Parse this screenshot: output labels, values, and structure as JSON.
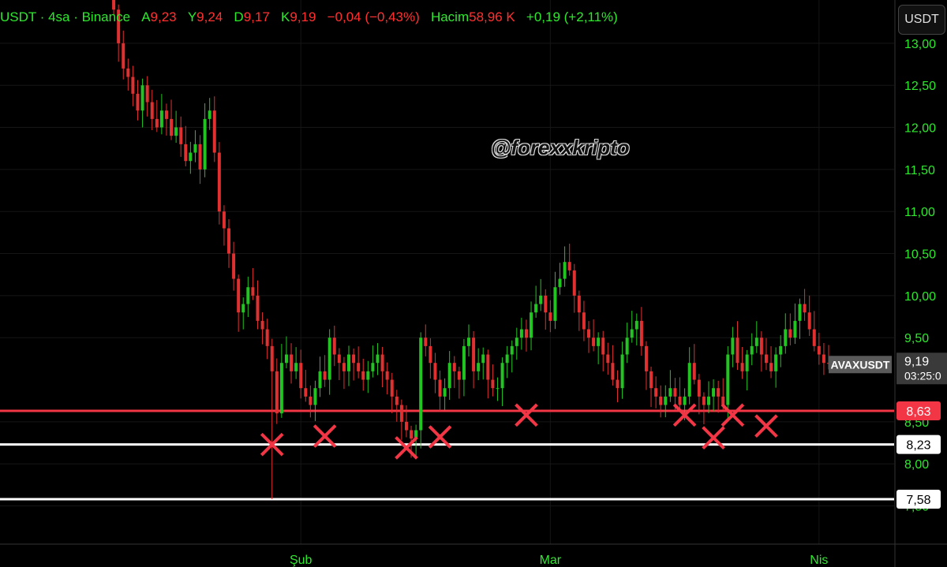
{
  "header": {
    "symbol": "USDT · 4sa · Binance",
    "open_label": "A",
    "open": "9,23",
    "high_label": "Y",
    "high": "9,24",
    "low_label": "D",
    "low": "9,17",
    "close_label": "K",
    "close": "9,19",
    "change": "−0,04 (−0,43%)",
    "volume_label": "Hacim",
    "volume": "58,96 K",
    "volume_change": "+0,19 (+2,11%)"
  },
  "currency_button": "USDT",
  "watermark": "@forexxkripto",
  "colors": {
    "background": "#000000",
    "up": "#22c422",
    "down": "#e03030",
    "axis_text": "#2ee82e",
    "support_red": "#f23645",
    "support_white": "#ffffff",
    "cross": "#f23645"
  },
  "chart_data": {
    "type": "line",
    "title": "",
    "ylim": [
      7.4,
      13.1
    ],
    "y_ticks": [
      "13,00",
      "12,50",
      "12,00",
      "11,50",
      "11,00",
      "10,50",
      "10,00",
      "9,50",
      "8,50",
      "8,00",
      "7,50"
    ],
    "y_tick_values": [
      13.0,
      12.5,
      12.0,
      11.5,
      11.0,
      10.5,
      10.0,
      9.5,
      8.5,
      8.0,
      7.5
    ],
    "x_ticks": [
      "Şub",
      "Mar",
      "Nis"
    ],
    "x_tick_index": [
      40,
      92,
      148
    ],
    "series": [
      {
        "values": [
          13.8,
          13.4,
          13.0,
          12.7,
          12.6,
          12.4,
          12.2,
          12.5,
          12.3,
          12.1,
          12.0,
          12.2,
          12.1,
          11.9,
          12.0,
          11.8,
          11.6,
          11.7,
          11.8,
          11.5,
          12.1,
          12.2,
          11.7,
          11.0,
          10.8,
          10.5,
          10.2,
          9.8,
          9.9,
          10.1,
          10.0,
          9.7,
          9.6,
          9.4,
          9.1,
          8.6,
          9.2,
          9.3,
          9.1,
          9.2,
          8.9,
          8.8,
          8.7,
          8.9,
          9.1,
          9.0,
          9.5,
          9.3,
          9.2,
          9.1,
          9.3,
          9.2,
          9.1,
          9.0,
          9.1,
          9.2,
          9.3,
          9.1,
          9.0,
          8.8,
          8.7,
          8.5,
          8.4,
          8.3,
          8.4,
          9.5,
          9.4,
          9.2,
          9.0,
          8.8,
          8.9,
          9.2,
          9.1,
          9.0,
          9.4,
          9.5,
          9.1,
          9.2,
          9.3,
          9.0,
          8.9,
          8.9,
          9.2,
          9.3,
          9.4,
          9.5,
          9.6,
          9.5,
          9.8,
          9.9,
          10.0,
          9.8,
          9.7,
          10.1,
          10.2,
          10.4,
          10.3,
          10.0,
          9.8,
          9.6,
          9.5,
          9.4,
          9.5,
          9.3,
          9.2,
          9.0,
          8.9,
          9.3,
          9.5,
          9.6,
          9.7,
          9.4,
          9.1,
          8.9,
          8.8,
          8.7,
          8.8,
          8.9,
          8.8,
          8.7,
          8.8,
          9.2,
          9.0,
          8.8,
          8.7,
          8.8,
          8.9,
          8.8,
          8.7,
          9.3,
          9.5,
          9.2,
          9.1,
          9.3,
          9.4,
          9.5,
          9.3,
          9.2,
          9.1,
          9.3,
          9.4,
          9.6,
          9.5,
          9.7,
          9.9,
          9.8,
          9.6,
          9.4,
          9.3,
          9.2,
          9.19
        ],
        "low_wicks": [
          {
            "index": 34,
            "value": 7.58
          }
        ]
      }
    ],
    "last_price_label": "AVAXUSDT",
    "last_price": "9,19",
    "countdown": "03:25:0",
    "levels": [
      {
        "value": 8.63,
        "label": "8,63",
        "color": "#f23645"
      },
      {
        "value": 8.23,
        "label": "8,23",
        "color": "#ffffff"
      },
      {
        "value": 7.58,
        "label": "7,58",
        "color": "#ffffff"
      }
    ],
    "cross_marks": [
      {
        "index": 34,
        "value": 8.23
      },
      {
        "index": 45,
        "value": 8.33
      },
      {
        "index": 62,
        "value": 8.19
      },
      {
        "index": 69,
        "value": 8.32
      },
      {
        "index": 87,
        "value": 8.58
      },
      {
        "index": 120,
        "value": 8.58
      },
      {
        "index": 126,
        "value": 8.31
      },
      {
        "index": 130,
        "value": 8.58
      },
      {
        "index": 137,
        "value": 8.45
      }
    ]
  }
}
